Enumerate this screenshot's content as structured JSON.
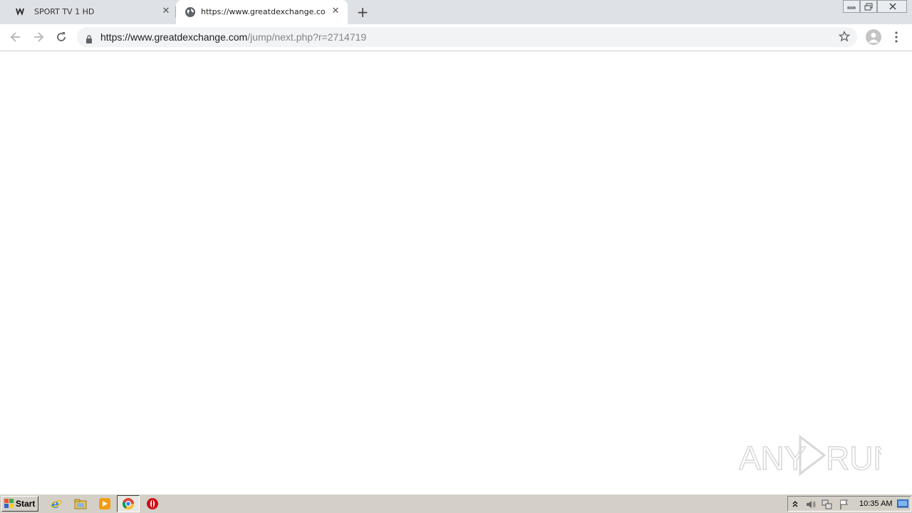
{
  "tabs": [
    {
      "title": "SPORT TV 1 HD",
      "favicon": "mask-icon",
      "active": false
    },
    {
      "title": "https://www.greatdexchange.com/j",
      "favicon": "globe-icon",
      "active": true
    }
  ],
  "omnibox": {
    "url_host": "https://www.greatdexchange.com",
    "url_path": "/jump/next.php?r=2714719"
  },
  "taskbar": {
    "start_label": "Start",
    "clock": "10:35 AM",
    "pinned": [
      "ie-icon",
      "explorer-icon",
      "media-player-icon",
      "chrome-icon",
      "opera-icon"
    ]
  },
  "watermark": {
    "text": "ANY RUN"
  }
}
